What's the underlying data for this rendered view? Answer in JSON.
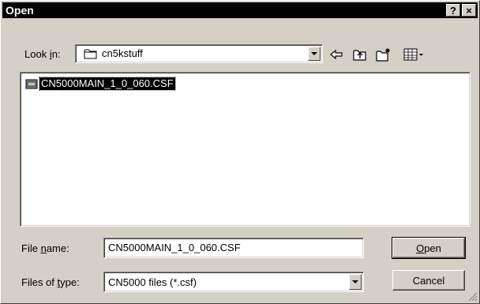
{
  "window": {
    "title": "Open",
    "help_label": "?",
    "close_label": "×"
  },
  "lookin": {
    "label_pre": "Look ",
    "label_key": "i",
    "label_post": "n:",
    "value": "cn5kstuff"
  },
  "toolbar": {
    "icons": [
      "back-icon",
      "up-folder-icon",
      "new-folder-icon",
      "view-menu-icon"
    ]
  },
  "files": [
    {
      "name": "CN5000MAIN_1_0_060.CSF",
      "icon": "csf-file-icon"
    }
  ],
  "filename": {
    "label_pre": "File ",
    "label_key": "n",
    "label_post": "ame:",
    "value": "CN5000MAIN_1_0_060.CSF"
  },
  "filetype": {
    "label_pre": "Files of ",
    "label_key": "t",
    "label_post": "ype:",
    "value": "CN5000 files (*.csf)"
  },
  "buttons": {
    "open_key": "O",
    "open_rest": "pen",
    "cancel": "Cancel"
  },
  "colors": {
    "face": "#d4d0c8",
    "titlebar": "#000000",
    "selection": "#000000"
  }
}
